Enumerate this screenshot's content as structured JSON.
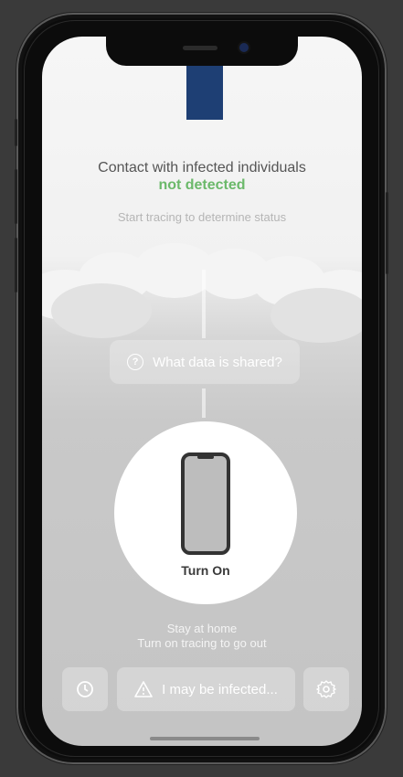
{
  "status": {
    "title": "Contact with infected individuals",
    "value": "not detected",
    "hint": "Start tracing to determine status",
    "value_color": "#6bb96a"
  },
  "data_shared_label": "What data is shared?",
  "main_button": {
    "label": "Turn On"
  },
  "hints": {
    "line1": "Stay at home",
    "line2": "Turn on tracing to go out"
  },
  "toolbar": {
    "history_icon": "clock-icon",
    "infected_label": "I may be infected...",
    "warning_icon": "warning-icon",
    "settings_icon": "gear-icon"
  },
  "colors": {
    "flag": "#1e3f74",
    "background": "#3a3a3a"
  }
}
